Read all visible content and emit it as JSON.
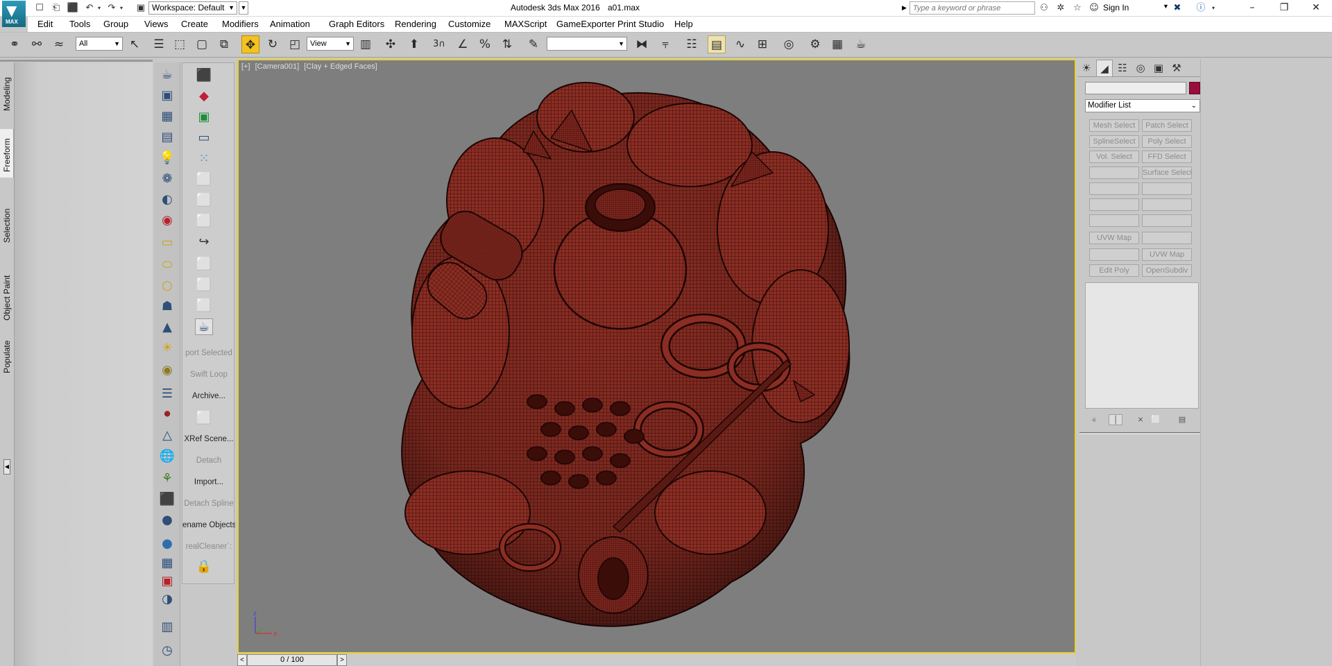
{
  "titlebar": {
    "app_title": "Autodesk 3ds Max 2016",
    "file_name": "a01.max",
    "workspace_label": "Workspace: Default",
    "logo_text": "MAX",
    "search_placeholder": "Type a keyword or phrase",
    "sign_in_label": "Sign In"
  },
  "menu": [
    "Edit",
    "Tools",
    "Group",
    "Views",
    "Create",
    "Modifiers",
    "Animation",
    "Graph Editors",
    "Rendering",
    "Customize",
    "MAXScript",
    "GameExporter",
    "Print Studio",
    "Help"
  ],
  "toolbar": {
    "selection_filter": "All",
    "reference_coord": "View",
    "snap_label": "3",
    "named_selection": ""
  },
  "ribbon_tabs": [
    "Modeling",
    "Freeform",
    "Selection",
    "Object Paint",
    "Populate"
  ],
  "ribbon_active": "Freeform",
  "script_buttons": [
    "port Selected",
    "Swift Loop",
    "Archive...",
    "XRef Scene...",
    "Detach",
    "Import...",
    "Detach Spline",
    "ename Objects",
    "realCleaner`:"
  ],
  "viewport": {
    "label_plus": "[+]",
    "label_camera": "[Camera001]",
    "label_shading": "[Clay + Edged Faces]",
    "object_color": "#8a2a22",
    "wire_color": "#2a0a06",
    "background_color": "#7e7e7e"
  },
  "timeline": {
    "frame_display": "0 / 100",
    "prev_label": "<",
    "next_label": ">"
  },
  "command_panel": {
    "object_name": "",
    "object_color": "#9b0d3f",
    "modifier_list_label": "Modifier List",
    "modifier_buttons": [
      "Mesh Select",
      "Patch Select",
      "SplineSelect",
      "Poly Select",
      "Vol. Select",
      "FFD Select",
      "",
      "Surface Select",
      "",
      "",
      "",
      "",
      "",
      "",
      "UVW Map",
      "",
      "",
      "UVW Map",
      "Edit Poly",
      "OpenSubdiv"
    ]
  }
}
